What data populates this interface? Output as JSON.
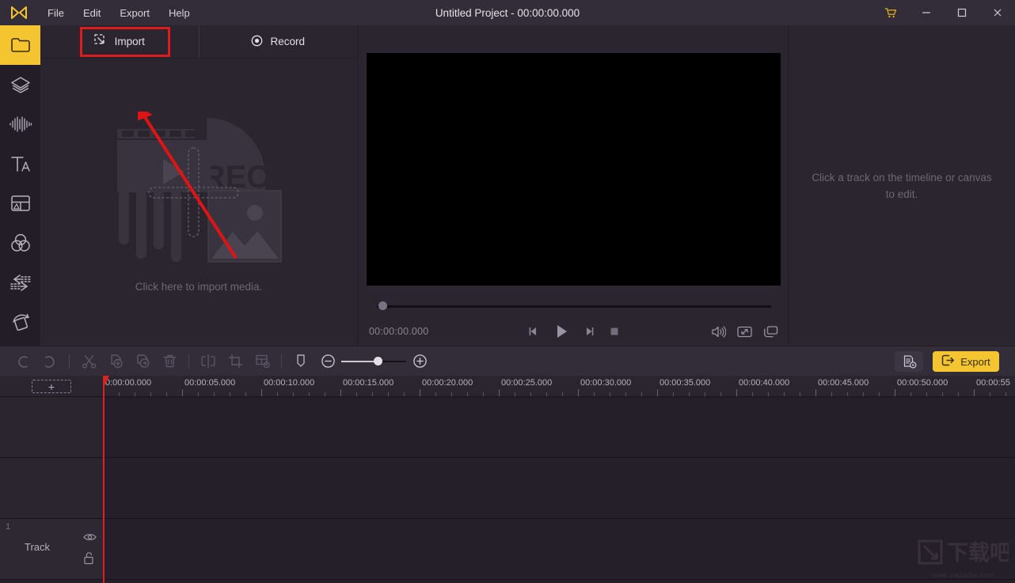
{
  "window": {
    "title": "Untitled Project - 00:00:00.000",
    "logo_icon": "app-logo-icon",
    "cart_icon": "cart-icon",
    "minimize_icon": "minimize-icon",
    "maximize_icon": "maximize-icon",
    "close_icon": "close-icon"
  },
  "menubar": {
    "items": [
      {
        "label": "File"
      },
      {
        "label": "Edit"
      },
      {
        "label": "Export"
      },
      {
        "label": "Help"
      }
    ]
  },
  "rail": {
    "items": [
      {
        "name": "media",
        "icon": "folder-icon",
        "active": true
      },
      {
        "name": "effects",
        "icon": "layers-icon",
        "active": false
      },
      {
        "name": "audio",
        "icon": "waveform-icon",
        "active": false
      },
      {
        "name": "text",
        "icon": "text-icon",
        "active": false
      },
      {
        "name": "overlays",
        "icon": "layout-icon",
        "active": false
      },
      {
        "name": "filters",
        "icon": "color-circles-icon",
        "active": false
      },
      {
        "name": "transitions",
        "icon": "transition-arrows-icon",
        "active": false
      },
      {
        "name": "elements",
        "icon": "rotate-shape-icon",
        "active": false
      }
    ]
  },
  "media_panel": {
    "tabs": [
      {
        "label": "Import",
        "icon": "import-arrow-icon",
        "selected": true
      },
      {
        "label": "Record",
        "icon": "record-dot-icon",
        "selected": false
      }
    ],
    "hint": "Click here to import media.",
    "art_label": "REC",
    "highlight_color": "#e01b1b"
  },
  "preview": {
    "timecode": "00:00:00.000",
    "controls": [
      {
        "name": "previous-frame",
        "icon": "prev-frame-icon"
      },
      {
        "name": "play",
        "icon": "play-icon"
      },
      {
        "name": "next-frame",
        "icon": "next-frame-icon"
      },
      {
        "name": "stop",
        "icon": "stop-icon"
      }
    ],
    "right_controls": [
      {
        "name": "volume",
        "icon": "speaker-icon"
      },
      {
        "name": "fullscreen",
        "icon": "expand-icon"
      },
      {
        "name": "pop-out",
        "icon": "window-icon"
      }
    ]
  },
  "right_panel": {
    "placeholder": "Click a track on the timeline or canvas to edit."
  },
  "toolbar": {
    "groups": [
      [
        {
          "name": "undo",
          "icon": "undo-icon"
        },
        {
          "name": "redo",
          "icon": "redo-icon"
        }
      ],
      [
        {
          "name": "cut",
          "icon": "scissors-icon"
        },
        {
          "name": "copy",
          "icon": "copy-icon"
        },
        {
          "name": "duplicate",
          "icon": "duplicate-icon"
        },
        {
          "name": "delete",
          "icon": "trash-icon"
        }
      ],
      [
        {
          "name": "split",
          "icon": "split-icon"
        },
        {
          "name": "crop",
          "icon": "crop-icon"
        },
        {
          "name": "speed",
          "icon": "speed-settings-icon"
        }
      ],
      [
        {
          "name": "marker",
          "icon": "marker-icon"
        }
      ]
    ],
    "zoom_out_icon": "zoom-out-icon",
    "zoom_in_icon": "zoom-in-icon",
    "settings_icon": "export-settings-icon",
    "export_label": "Export",
    "export_icon": "export-arrow-icon",
    "accent_color": "#f5c431"
  },
  "timeline": {
    "add_track_label": "+",
    "ruler": {
      "labels": [
        "0:00:00.000",
        "00:00:05.000",
        "00:00:10.000",
        "00:00:15.000",
        "00:00:20.000",
        "00:00:25.000",
        "00:00:30.000",
        "00:00:35.000",
        "00:00:40.000",
        "00:00:45.000",
        "00:00:50.000",
        "00:00:55"
      ],
      "major_spacing_px": 100,
      "minor_per_major": 5
    },
    "tracks": [
      {
        "number": "",
        "name": "",
        "named": false
      },
      {
        "number": "",
        "name": "",
        "named": false
      },
      {
        "number": "1",
        "name": "Track",
        "named": true,
        "eye_icon": "eye-icon",
        "lock_icon": "unlock-icon"
      }
    ],
    "playhead_color": "#e02020"
  },
  "watermark": {
    "logo_text": "下载吧",
    "url_text": "www.xiazaiba.com"
  }
}
